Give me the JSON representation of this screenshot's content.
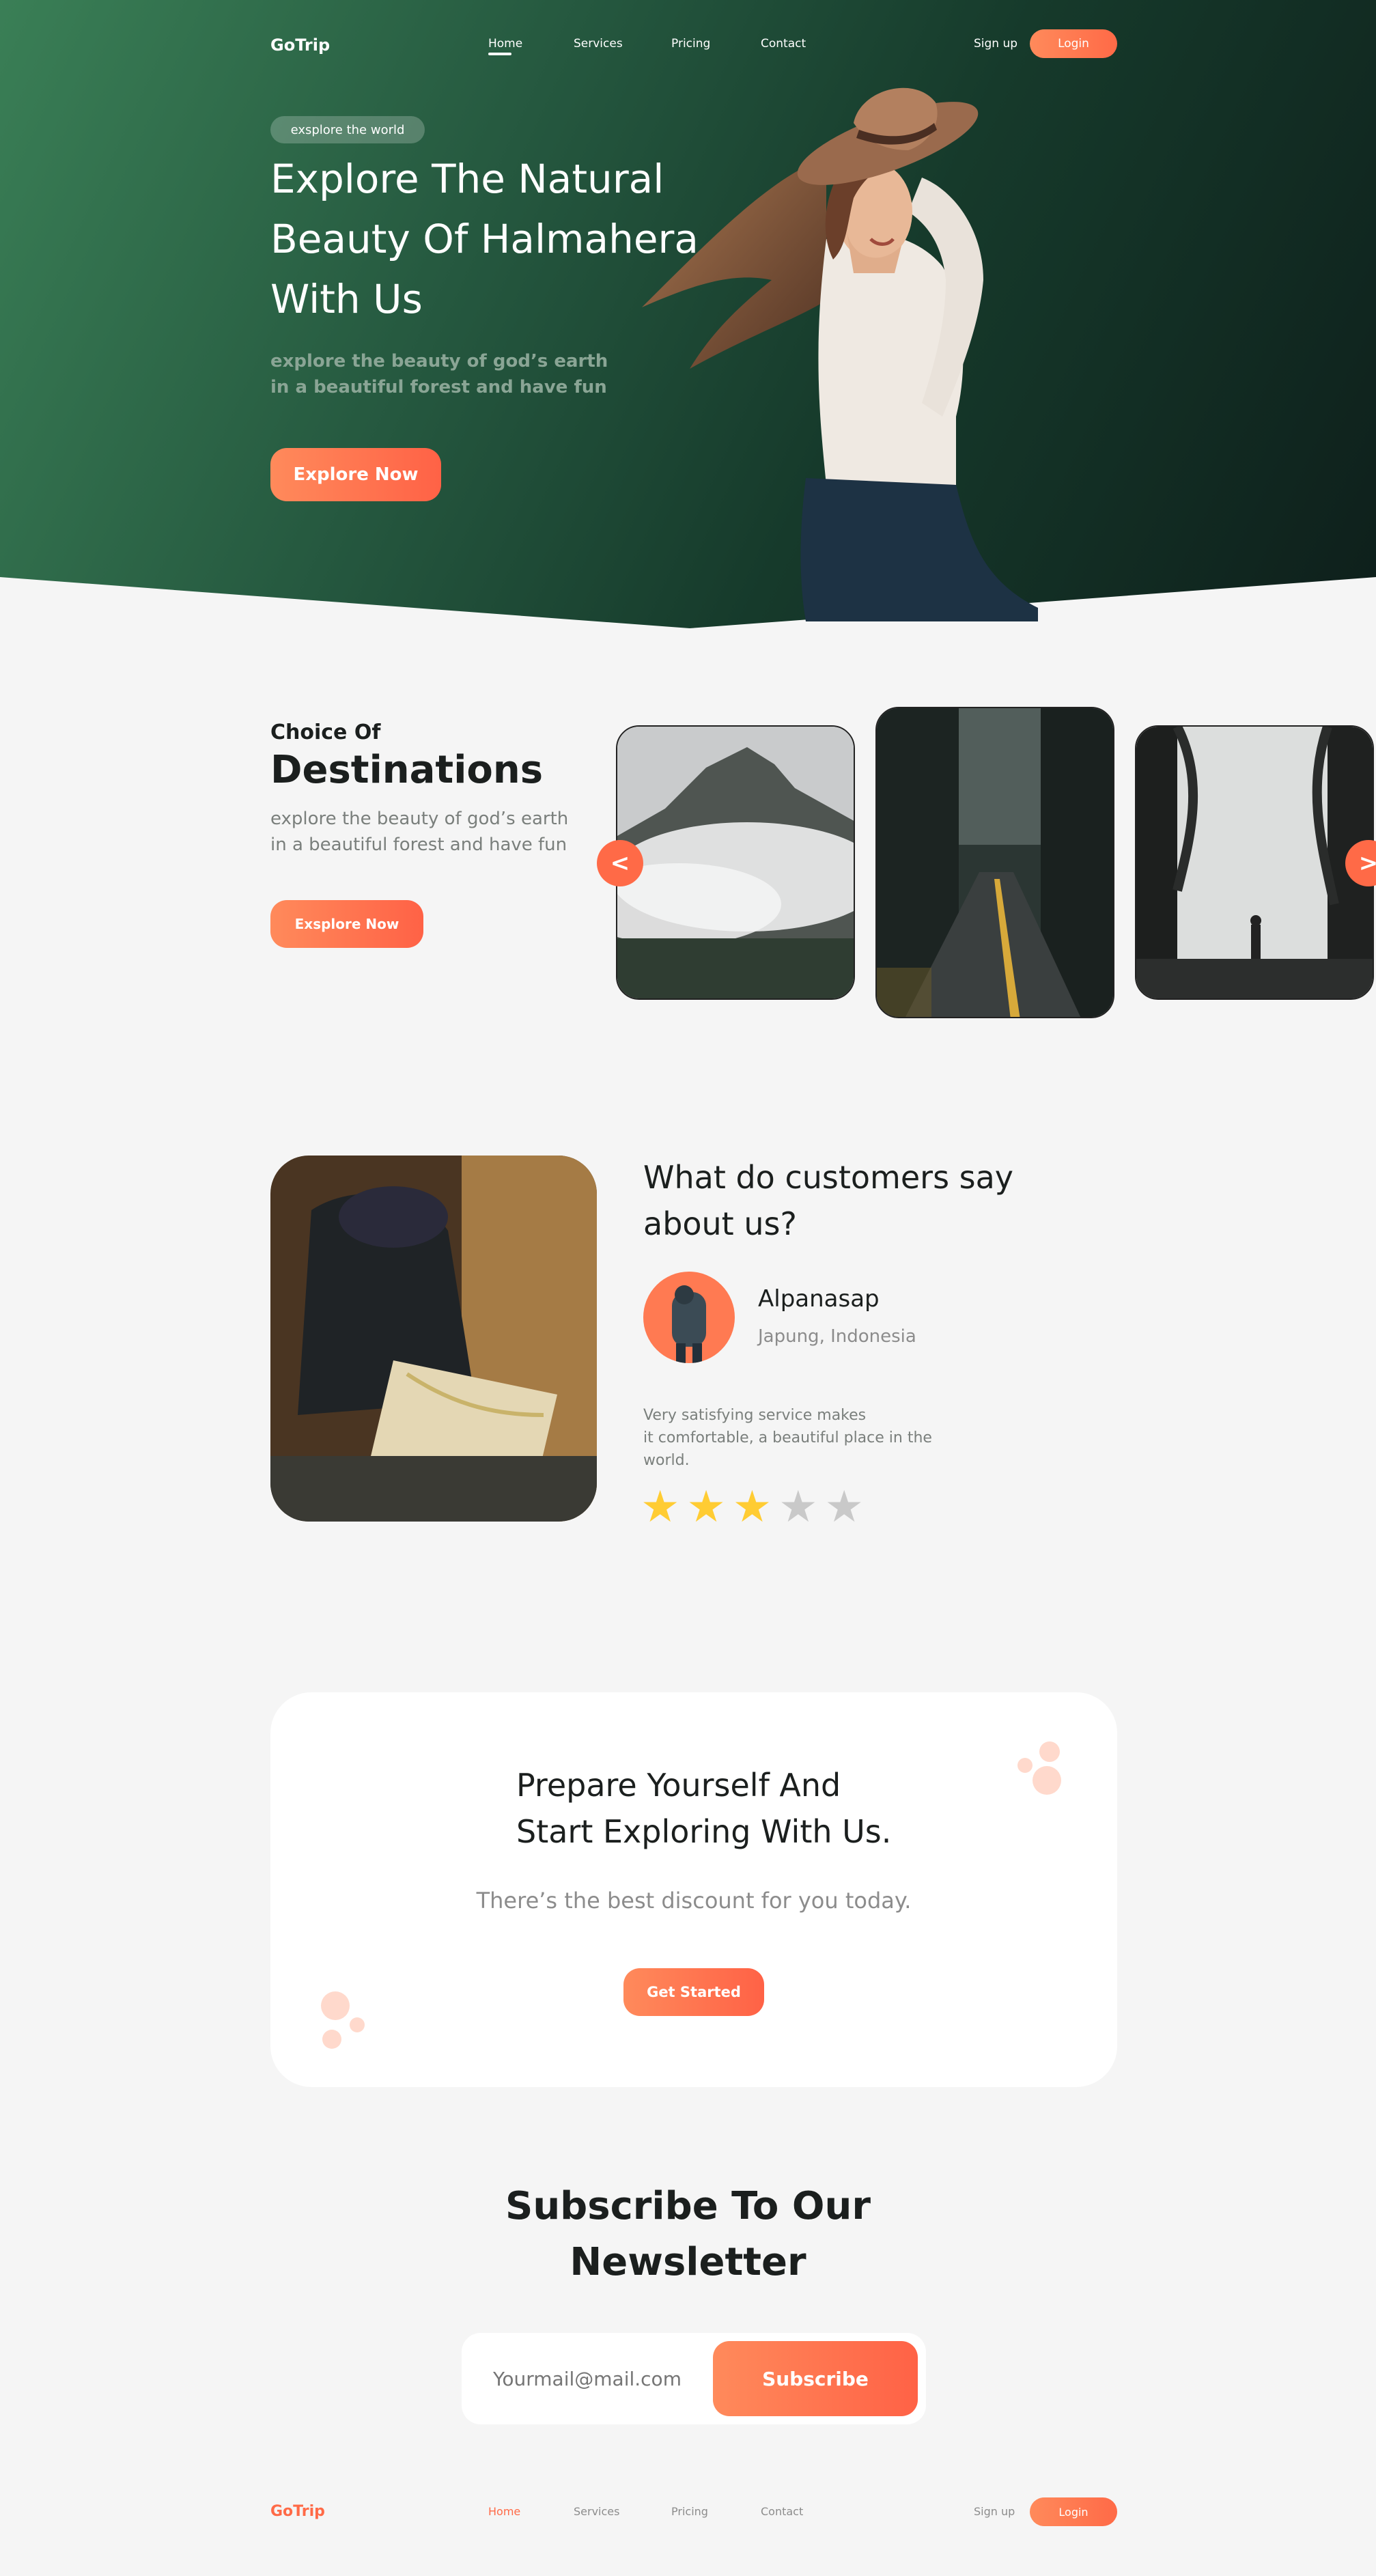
{
  "brand": {
    "name": "GoTrip",
    "accent": "#ff6a47",
    "dark": "#163a2b"
  },
  "nav": {
    "items": [
      "Home",
      "Services",
      "Pricing",
      "Contact"
    ],
    "active": "Home",
    "signup": "Sign up",
    "login": "Login"
  },
  "hero": {
    "pill": "exsplore the world",
    "title_line1": "Explore The Natural",
    "title_line2": "Beauty Of Halmahera",
    "title_line3": "With Us",
    "subtitle_line1": "explore the beauty of god’s earth",
    "subtitle_line2": "in a beautiful forest and have fun",
    "cta": "Explore Now"
  },
  "destinations": {
    "kicker": "Choice Of",
    "title": "Destinations",
    "text_line1": "explore the beauty of god’s earth",
    "text_line2": "in a beautiful forest and have fun",
    "cta": "Exsplore Now",
    "prev_icon": "<",
    "next_icon": ">"
  },
  "testimonial": {
    "title_line1": "What do customers say",
    "title_line2": "about us?",
    "name": "Alpanasap",
    "location": "Japung, Indonesia",
    "quote_line1": "Very satisfying service makes",
    "quote_line2": "it comfortable, a beautiful place in the",
    "quote_line3": "world.",
    "rating": 3,
    "rating_max": 5,
    "star_on": "#ffcc33",
    "star_off": "#c9c9c9"
  },
  "promo": {
    "title_line1": "Prepare Yourself And",
    "title_line2": "Start Exploring With Us.",
    "subtitle": "There’s the best discount for you today.",
    "cta": "Get Started"
  },
  "newsletter": {
    "title_line1": "Subscribe To Our",
    "title_line2": "Newsletter",
    "placeholder": "Yourmail@mail.com",
    "button": "Subscribe"
  },
  "footer": {
    "items": [
      "Home",
      "Services",
      "Pricing",
      "Contact"
    ],
    "signup": "Sign up",
    "login": "Login"
  }
}
